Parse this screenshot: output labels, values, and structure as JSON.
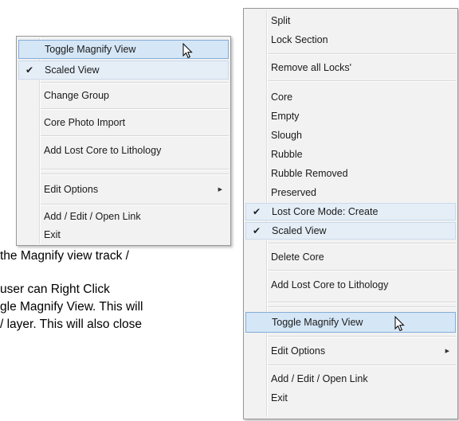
{
  "menu_small": {
    "items": [
      {
        "label": "Toggle Magnify View",
        "highlighted": true,
        "checked": false
      },
      {
        "label": "Scaled View",
        "highlighted": false,
        "checked": true
      },
      {
        "label": "Change Group"
      },
      {
        "label": "Core Photo Import"
      },
      {
        "label": "Add Lost Core to Lithology"
      },
      {
        "label": "Edit Options",
        "submenu": true
      },
      {
        "label": "Add / Edit / Open Link"
      },
      {
        "label": "Exit"
      }
    ]
  },
  "menu_large": {
    "items": [
      {
        "label": "Split"
      },
      {
        "label": "Lock Section"
      },
      {
        "label": "Remove all Locks'"
      },
      {
        "label": "Core"
      },
      {
        "label": "Empty"
      },
      {
        "label": "Slough"
      },
      {
        "label": "Rubble"
      },
      {
        "label": "Rubble Removed"
      },
      {
        "label": "Preserved"
      },
      {
        "label": "Lost Core Mode: Create",
        "checked": true
      },
      {
        "label": "Scaled View",
        "checked": true
      },
      {
        "label": "Delete Core"
      },
      {
        "label": "Add Lost Core to Lithology"
      },
      {
        "label": "Toggle Magnify View",
        "highlighted": true
      },
      {
        "label": "Edit Options",
        "submenu": true
      },
      {
        "label": "Add / Edit / Open Link"
      },
      {
        "label": "Exit"
      }
    ]
  },
  "icons": {
    "check": "checkmark-icon",
    "submenu": "submenu-arrow-icon",
    "cursor": "mouse-pointer-icon"
  },
  "body_text": {
    "line1": "the Magnify view track /",
    "line2": "user can Right Click",
    "line3": "gle Magnify View. This will",
    "line4": "/ layer. This will also close"
  },
  "colors": {
    "highlight": "#d5e6f6",
    "highlight_border": "#84acd9",
    "menu_bg": "#f2f2f2"
  }
}
